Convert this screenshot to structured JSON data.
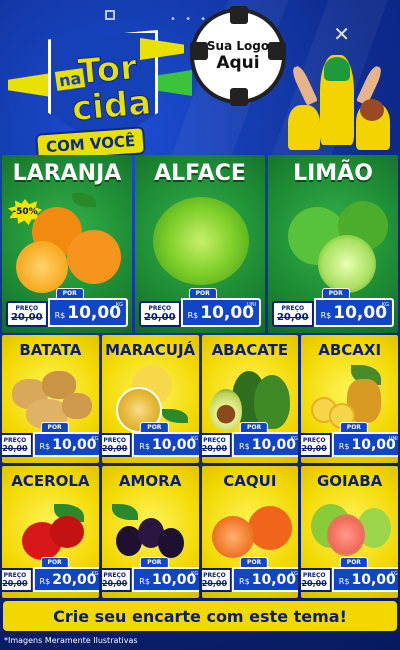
{
  "header": {
    "logo_na": "na",
    "logo_tor": "Tor",
    "logo_cida": "cida",
    "logo_comvoce": "COM VOCÊ",
    "ball_line1": "Sua Logo",
    "ball_line2": "Aqui"
  },
  "products": [
    {
      "name": "LARANJA",
      "old_label": "PREÇO",
      "old_price": "20,00",
      "por": "POR",
      "currency": "R$",
      "price": "10,00",
      "unit": "KG",
      "badge": "-50%"
    },
    {
      "name": "ALFACE",
      "old_label": "PREÇO",
      "old_price": "20,00",
      "por": "POR",
      "currency": "R$",
      "price": "10,00",
      "unit": "UNI"
    },
    {
      "name": "LIMÃO",
      "old_label": "PREÇO",
      "old_price": "20,00",
      "por": "POR",
      "currency": "R$",
      "price": "10,00",
      "unit": "KG"
    },
    {
      "name": "BATATA",
      "old_label": "PREÇO",
      "old_price": "20,00",
      "por": "POR",
      "currency": "R$",
      "price": "10,00",
      "unit": "KG"
    },
    {
      "name": "MARACUJÁ",
      "old_label": "PREÇO",
      "old_price": "20,00",
      "por": "POR",
      "currency": "R$",
      "price": "10,00",
      "unit": "KG"
    },
    {
      "name": "ABACATE",
      "old_label": "PREÇO",
      "old_price": "20,00",
      "por": "POR",
      "currency": "R$",
      "price": "10,00",
      "unit": "KG"
    },
    {
      "name": "ABCAXI",
      "old_label": "PREÇO",
      "old_price": "20,00",
      "por": "POR",
      "currency": "R$",
      "price": "10,00",
      "unit": "UNI"
    },
    {
      "name": "ACEROLA",
      "old_label": "PREÇO",
      "old_price": "20,00",
      "por": "POR",
      "currency": "R$",
      "price": "20,00",
      "unit": "KG"
    },
    {
      "name": "AMORA",
      "old_label": "PREÇO",
      "old_price": "20,00",
      "por": "POR",
      "currency": "R$",
      "price": "10,00",
      "unit": "KG"
    },
    {
      "name": "CAQUI",
      "old_label": "PREÇO",
      "old_price": "20,00",
      "por": "POR",
      "currency": "R$",
      "price": "10,00",
      "unit": "KG"
    },
    {
      "name": "GOIABA",
      "old_label": "PREÇO",
      "old_price": "20,00",
      "por": "POR",
      "currency": "R$",
      "price": "10,00",
      "unit": "KG"
    }
  ],
  "banner": "Crie seu encarte com este tema!",
  "footnote": "*Imagens Meramente Ilustrativas",
  "colors": {
    "blue": "#1145c8",
    "green": "#1d8a34",
    "yellow": "#f2d800",
    "navy": "#0b1e70"
  }
}
